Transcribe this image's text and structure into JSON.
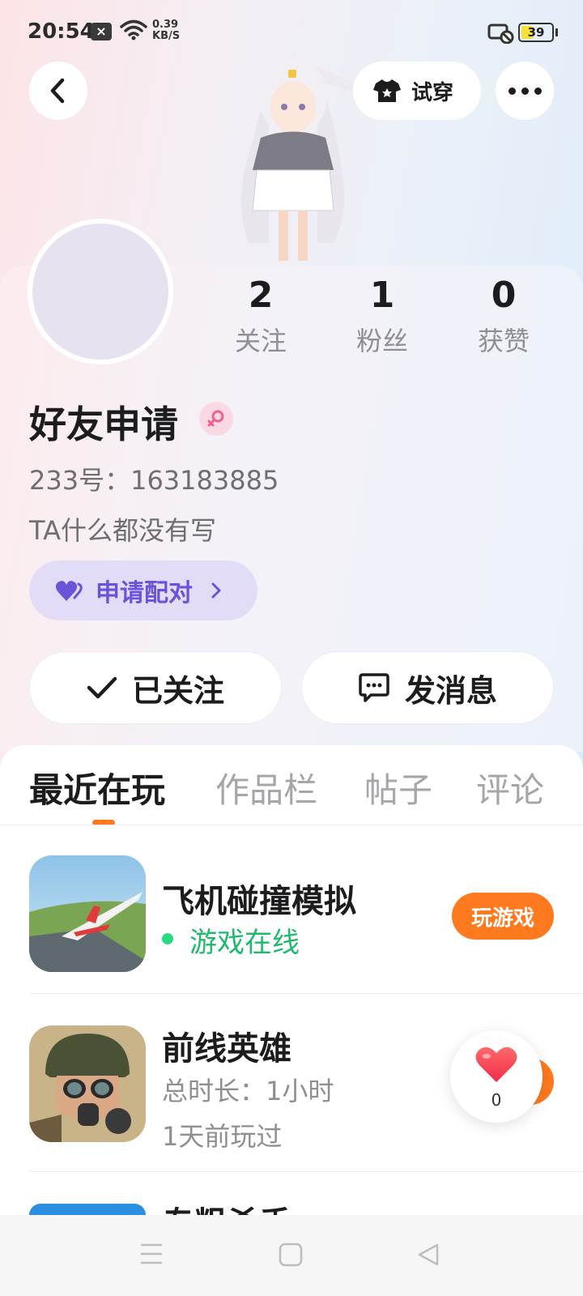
{
  "status_bar": {
    "time": "20:54",
    "net_speed_value": "0.39",
    "net_speed_unit": "KB/S",
    "battery": "39",
    "battery_level_percent": 39
  },
  "header": {
    "tryon_label": "试穿"
  },
  "profile": {
    "stats": [
      {
        "value": "2",
        "label": "关注"
      },
      {
        "value": "1",
        "label": "粉丝"
      },
      {
        "value": "0",
        "label": "获赞"
      }
    ],
    "username": "好友申请",
    "user_id": "233号：163183885",
    "bio": "TA什么都没有写",
    "pair_label": "申请配对",
    "follow_label": "已关注",
    "message_label": "发消息"
  },
  "tabs": [
    {
      "label": "最近在玩",
      "active": true
    },
    {
      "label": "作品栏",
      "active": false
    },
    {
      "label": "帖子",
      "active": false
    },
    {
      "label": "评论",
      "active": false
    }
  ],
  "games": [
    {
      "title": "飞机碰撞模拟",
      "status": "游戏在线",
      "button": "玩游戏"
    },
    {
      "title": "前线英雄",
      "duration": "总时长：1小时",
      "last_played": "1天前玩过"
    },
    {
      "title": "专粗杀手"
    }
  ],
  "like": {
    "count": "0"
  },
  "colors": {
    "accent": "#ff7a1f",
    "online": "#1fb96e",
    "pair_text": "#6b52d9",
    "pair_bg": "#e3dcf7"
  },
  "icons": [
    "back-icon",
    "tshirt-icon",
    "more-icon",
    "female-icon",
    "heart-icon",
    "check-icon",
    "chat-icon",
    "menu-icon",
    "home-icon",
    "back-triangle-icon"
  ]
}
